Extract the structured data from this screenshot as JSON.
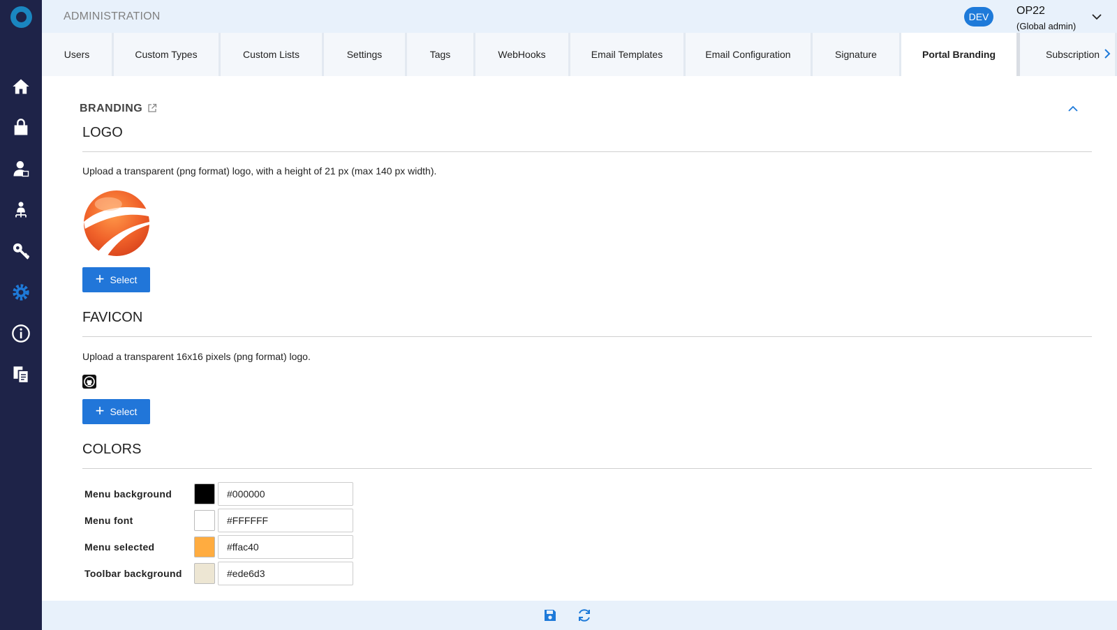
{
  "header": {
    "title": "ADMINISTRATION",
    "env_badge": "DEV",
    "user_name": "OP22",
    "user_role": "(Global admin)"
  },
  "tabs": [
    {
      "label": "Users",
      "active": false
    },
    {
      "label": "Custom Types",
      "active": false
    },
    {
      "label": "Custom Lists",
      "active": false
    },
    {
      "label": "Settings",
      "active": false
    },
    {
      "label": "Tags",
      "active": false
    },
    {
      "label": "WebHooks",
      "active": false
    },
    {
      "label": "Email Templates",
      "active": false
    },
    {
      "label": "Email Configuration",
      "active": false
    },
    {
      "label": "Signature",
      "active": false
    },
    {
      "label": "Portal Branding",
      "active": true
    },
    {
      "label": "Subscription",
      "active": false
    }
  ],
  "sidebar": {
    "items": [
      {
        "icon": "home-icon"
      },
      {
        "icon": "shopping-bag-icon"
      },
      {
        "icon": "user-icon"
      },
      {
        "icon": "org-chart-icon"
      },
      {
        "icon": "key-icon"
      },
      {
        "icon": "gear-icon"
      },
      {
        "icon": "info-icon"
      },
      {
        "icon": "documents-icon"
      }
    ],
    "selected_color": "#1e7ad9"
  },
  "branding": {
    "heading": "BRANDING",
    "logo": {
      "title": "LOGO",
      "description": "Upload a transparent (png format) logo, with a height of 21 px (max 140 px width).",
      "button": "Select"
    },
    "favicon": {
      "title": "FAVICON",
      "description": "Upload a transparent 16x16 pixels (png format) logo.",
      "button": "Select"
    },
    "colors": {
      "title": "COLORS",
      "rows": [
        {
          "label": "Menu background",
          "value": "#000000"
        },
        {
          "label": "Menu font",
          "value": "#FFFFFF"
        },
        {
          "label": "Menu selected",
          "value": "#ffac40"
        },
        {
          "label": "Toolbar background",
          "value": "#ede6d3"
        }
      ]
    }
  }
}
